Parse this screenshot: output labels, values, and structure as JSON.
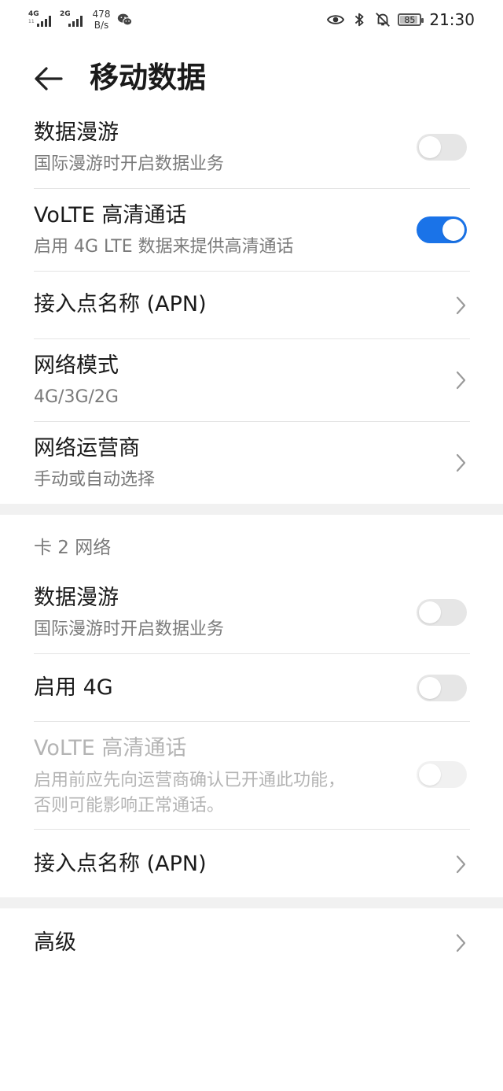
{
  "status_bar": {
    "sim1_gen": "4G",
    "sim1_sub": "11",
    "sim2_gen": "2G",
    "speed_value": "478",
    "speed_unit": "B/s",
    "battery": "85",
    "time": "21:30",
    "icons": [
      "eye-comfort-icon",
      "bluetooth-icon",
      "mute-icon",
      "battery-icon",
      "wechat-icon"
    ]
  },
  "header": {
    "title": "移动数据"
  },
  "sim1": {
    "data_roaming": {
      "title": "数据漫游",
      "subtitle": "国际漫游时开启数据业务",
      "enabled": false
    },
    "volte": {
      "title": "VoLTE 高清通话",
      "subtitle": "启用 4G LTE 数据来提供高清通话",
      "enabled": true
    },
    "apn": {
      "title": "接入点名称 (APN)"
    },
    "network_mode": {
      "title": "网络模式",
      "subtitle": "4G/3G/2G"
    },
    "carrier": {
      "title": "网络运营商",
      "subtitle": "手动或自动选择"
    }
  },
  "sim2": {
    "section_label": "卡 2 网络",
    "data_roaming": {
      "title": "数据漫游",
      "subtitle": "国际漫游时开启数据业务",
      "enabled": false
    },
    "enable_4g": {
      "title": "启用 4G",
      "enabled": false
    },
    "volte": {
      "title": "VoLTE 高清通话",
      "subtitle_line1": "启用前应先向运营商确认已开通此功能，",
      "subtitle_line2": "否则可能影响正常通话。",
      "enabled": false,
      "disabled": true
    },
    "apn": {
      "title": "接入点名称 (APN)"
    }
  },
  "advanced": {
    "title": "高级"
  },
  "colors": {
    "accent": "#1a73e8",
    "toggle_off": "#e6e6e6",
    "divider": "#e4e4e4",
    "section_bg": "#f1f1f1"
  }
}
